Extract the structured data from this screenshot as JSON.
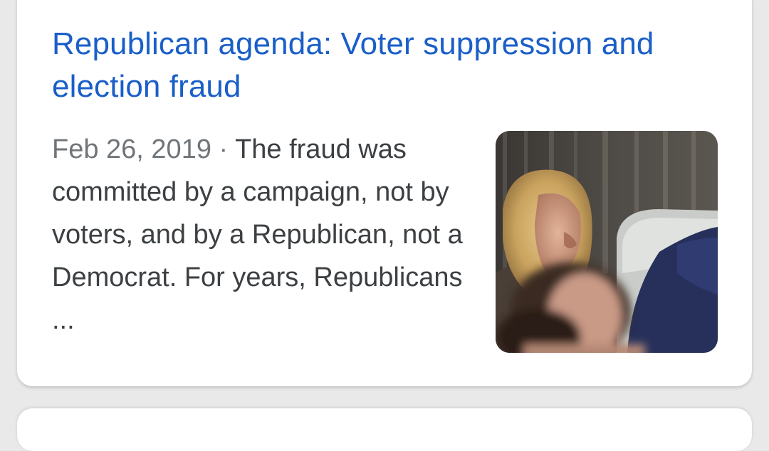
{
  "result": {
    "title": "Republican agenda: Voter suppression and election fraud",
    "date": "Feb 26, 2019",
    "separator": "·",
    "snippet": "The fraud was committed by a campaign, not by voters, and by a Republican, not a Democrat. For years, Republicans ...",
    "link_color": "#1a5fc8"
  },
  "thumbnail": {
    "subject": "woman with blonde hair seated in a hearing room"
  }
}
